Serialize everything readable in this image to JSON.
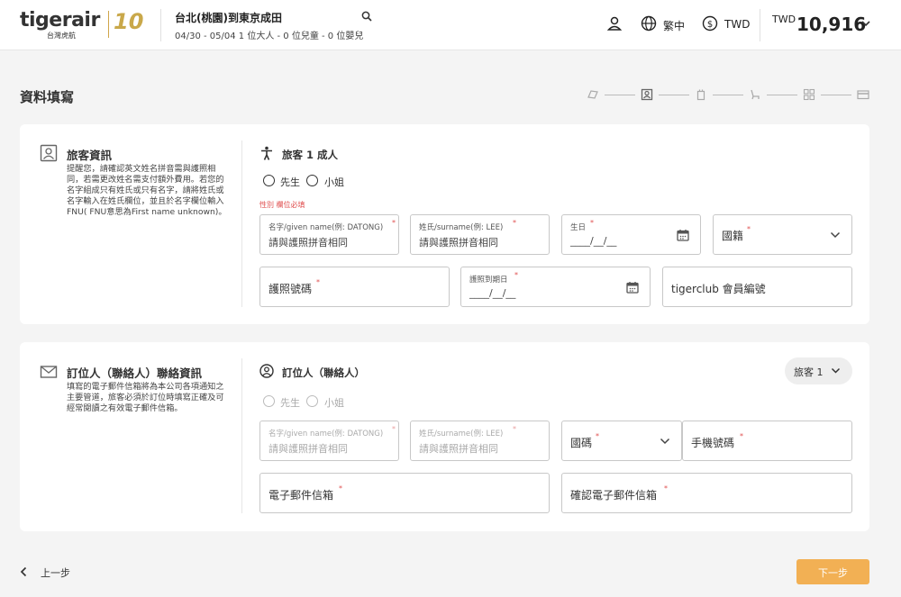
{
  "header": {
    "logo_text": "tigerair",
    "logo_sub": "台灣虎航",
    "anniversary": "10",
    "route": "台北(桃園)到東京成田",
    "route_details": "04/30 - 05/04   1 位大人 - 0 位兒童 - 0 位嬰兒",
    "language": "繁中",
    "currency": "TWD",
    "price_currency": "TWD",
    "price": "10,916"
  },
  "page": {
    "title": "資料填寫"
  },
  "stepper": {
    "icons": [
      "ticket-icon",
      "passenger-icon",
      "luggage-icon",
      "seat-icon",
      "grid-icon",
      "card-icon"
    ]
  },
  "passenger": {
    "side_title": "旅客資訊",
    "side_desc": "提醒您，請確認英文姓名拼音需與護照相同，若需更改姓名需支付額外費用。若您的名字組成只有姓氏或只有名字，請將姓氏或名字輸入在姓氏欄位，並且於名字欄位輸入FNU( FNU意思為First name unknown)。",
    "section_title": "旅客 1 成人",
    "gender_options": [
      "先生",
      "小姐"
    ],
    "gender_required_note": "性別 欄位必填",
    "fields": {
      "given_name_label": "名字/given name(例: DATONG)",
      "given_name_value": "請與護照拼音相同",
      "surname_label": "姓氏/surname(例: LEE)",
      "surname_value": "請與護照拼音相同",
      "birthday_label": "生日",
      "birthday_value": "____/__/__",
      "nationality": "國籍",
      "passport_no": "護照號碼",
      "passport_expiry_label": "護照到期日",
      "passport_expiry_value": "____/__/__",
      "tigerclub": "tigerclub 會員編號"
    }
  },
  "contact": {
    "side_title": "訂位人（聯絡人）聯絡資訊",
    "side_desc": "填寫的電子郵件信箱將為本公司各項通知之主要管道，旅客必須於訂位時填寫正確及可經常閱讀之有效電子郵件信箱。",
    "section_title": "訂位人（聯絡人）",
    "passenger_select": "旅客 1",
    "gender_options": [
      "先生",
      "小姐"
    ],
    "fields": {
      "given_name_label": "名字/given name(例: DATONG)",
      "given_name_value": "請與護照拼音相同",
      "surname_label": "姓氏/surname(例: LEE)",
      "surname_value": "請與護照拼音相同",
      "country_code": "國碼",
      "phone": "手機號碼",
      "email": "電子郵件信箱",
      "email_confirm": "確認電子郵件信箱"
    }
  },
  "footer": {
    "back_label": "上一步",
    "next_label": "下一步"
  },
  "colors": {
    "accent": "#f2b054",
    "required": "#e05050",
    "background": "#f4f4f4"
  }
}
